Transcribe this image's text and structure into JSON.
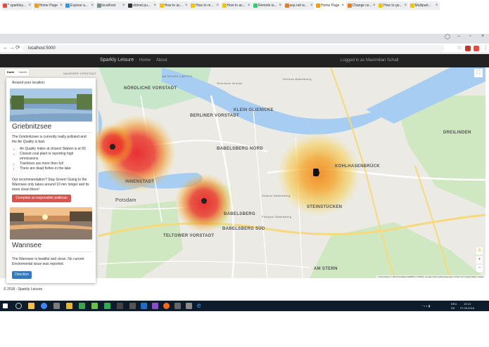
{
  "browser": {
    "tabs": [
      {
        "label": "* sparkley..."
      },
      {
        "label": "Home Page"
      },
      {
        "label": "Expose a..."
      },
      {
        "label": "localhost"
      },
      {
        "label": "dotnet pu..."
      },
      {
        "label": "How to ac..."
      },
      {
        "label": "How to re..."
      },
      {
        "label": "How to ac..."
      },
      {
        "label": "Remote is..."
      },
      {
        "label": "asp.net w..."
      },
      {
        "label": "Home Page"
      },
      {
        "label": "Change ce..."
      },
      {
        "label": "How to go..."
      },
      {
        "label": "Multipart..."
      }
    ],
    "url": "localhost:5000",
    "reload_glyph": "⟳",
    "back_glyph": "←",
    "forward_glyph": "→",
    "minimize_glyph": "–",
    "maximize_glyph": "▫",
    "close_glyph": "×",
    "menu_glyph": "⋮",
    "star_glyph": "☆"
  },
  "app": {
    "brand": "Sparkly Leisure",
    "nav": {
      "home": "Home",
      "about": "About"
    },
    "user_status": "Logged in as Maximilian Schall"
  },
  "map": {
    "type_controls": {
      "map": "Karte",
      "satellite": "Satellit"
    },
    "labels": {
      "nordliche_vorstadt": "NÖRDLICHE VORSTADT",
      "babelsberg_nord": "BABELSBERG NORD",
      "babelsberg": "BABELSBERG",
      "babelsberg_sud": "BABELSBERG SÜD",
      "potsdam": "Potsdam",
      "innenstadt": "INNENSTADT",
      "teltower_vorstadt": "TELTOWER VORSTADT",
      "klein_glienicke": "KLEIN GLIENICKE",
      "steinstucken": "STEINSTÜCKEN",
      "dreilinden": "DREILINDEN",
      "kohlhasenbruck": "KOHLHASENBRÜCK",
      "am_stern": "AM STERN",
      "berliner_vorstadt": "BERLINER VORSTADT",
      "glienicker_brucke": "Glienicker Brücke",
      "schloss_babelsberg": "Schloss Babelsberg",
      "filmpark": "Filmpark Babelsberg",
      "stadion": "Stadion Babelsberg",
      "nauener_vorstadt": "NAUENER VORSTADT",
      "am_neuen_garten": "AM NEUEN GARTEN"
    },
    "attribution": "Kartendaten © 2018 GeoBasis-DE/BKG (©2009), Google   Nutzungsbedingungen   Fehler bei Google Maps melden",
    "fullscreen_glyph": "⛶",
    "zoom_in": "+",
    "zoom_out": "−",
    "pegman_glyph": "♙",
    "heat_colors": {
      "high": "#e8262b",
      "mid": "#f08a24",
      "low": "#f7c934"
    }
  },
  "sidebar": {
    "heading": "Around your location:",
    "lakes": [
      {
        "name": "Griebnitzsee",
        "description": "The Griebnitzsee is currently really polluted and the Air Quality is bad.",
        "bullets": [
          "Air Quality Index at closest Station is at 60",
          "Closest coal plant is reporting high emmissions",
          "Trainlines are more then full",
          "There are dead fishes in the lake"
        ],
        "recommendation": "Our recommendation? Stay Green! Going to the Wannsee only takes around 10 min longer and its more clean there!",
        "button": "Complain at responsible politican",
        "button_color": "#d9534f"
      },
      {
        "name": "Wannsee",
        "description": "The Wannsee is beatiful and clean. No current Enviromental issue was reported.",
        "button": "Direction",
        "button_color": "#337ab7"
      }
    ]
  },
  "footer": "© 2018 - Sparkly Leisure",
  "taskbar": {
    "language": "DEU",
    "language_sub": "DE",
    "time": "10:13",
    "date": "27.05.2018"
  }
}
